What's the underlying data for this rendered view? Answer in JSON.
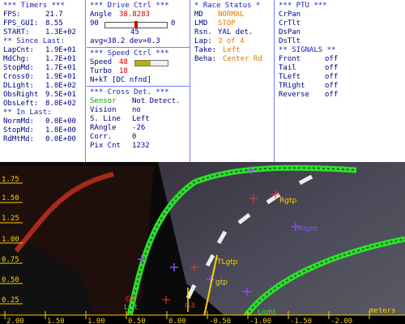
{
  "timers": {
    "title": "*** Timers ***",
    "rows": [
      {
        "label": "FPS:",
        "value": "21.7"
      },
      {
        "label": "FPS_GUI:",
        "value": "8.55"
      },
      {
        "label": "START:",
        "value": "1.3E+02"
      }
    ],
    "since_title": "** Since Last:",
    "since_rows": [
      {
        "label": "LapCnt:",
        "value": "1.9E+01"
      },
      {
        "label": "MdChg:",
        "value": "1.7E+01"
      },
      {
        "label": "StopMd:",
        "value": "1.7E+01"
      },
      {
        "label": "Cross0:",
        "value": "1.9E+01"
      },
      {
        "label": "DLight:",
        "value": "1.0E+02"
      },
      {
        "label": "ObsRight",
        "value": "9.5E+01"
      },
      {
        "label": "ObsLeft:",
        "value": "8.0E+02"
      }
    ],
    "inlast_title": "** In Last:",
    "inlast_rows": [
      {
        "label": "NormMd:",
        "value": "0.0E+00"
      },
      {
        "label": "StopMd:",
        "value": "1.8E+00"
      },
      {
        "label": "RdMtMd:",
        "value": "0.0E+00"
      }
    ]
  },
  "drive": {
    "title": "***  Drive Ctrl  ***",
    "angle_label": "Angle",
    "angle_value": "38.8283",
    "slider_min": "90",
    "slider_max": "0",
    "slider_level": 0.5,
    "slider_value": "45",
    "avg_text": "avg=38.2  dev=0.3",
    "speed_title": "***  Speed Ctrl  ***",
    "speed_label": "Speed",
    "speed_value": "48",
    "speed_gauge_level": 0.48,
    "turbo_label": "Turbo",
    "turbo_value": "18",
    "nkt_text": "N+kT [DC nfnd]",
    "cross_title": "*** Cross Det. ***",
    "sensor_label": "Sensor",
    "sensor_value": "Not Detect.",
    "vision_label": "Vision",
    "vision_value": "no",
    "sline_label": "S. Line",
    "sline_value": "Left",
    "rangle_label": "RAngle",
    "rangle_value": "-26",
    "corr_label": "Corr.",
    "corr_value": "0",
    "pix_label": "Pix Cnt",
    "pix_value": "1232"
  },
  "race": {
    "title": "* Race Status *",
    "rows": [
      {
        "label": "MD",
        "value": "NORMAL"
      },
      {
        "label": "LMD",
        "value": "STOP"
      },
      {
        "label": "Rsn.",
        "value": "YAL det."
      },
      {
        "label": "Lap:",
        "value": "3 of 4"
      },
      {
        "label": "Take:",
        "value": "Left"
      },
      {
        "label": "Beha:",
        "value": "Center Rd"
      }
    ]
  },
  "ptu": {
    "title": "*** PTU ***",
    "items": [
      "CrPan",
      "CrTlt",
      "DsPan",
      "DsTlt"
    ],
    "signals_title": "** SIGNALS **",
    "signals": [
      {
        "label": "Front",
        "value": "off"
      },
      {
        "label": "Tail",
        "value": "off"
      },
      {
        "label": "TLeft",
        "value": "off"
      },
      {
        "label": "TRight",
        "value": "off"
      },
      {
        "label": "Reverse",
        "value": "off"
      }
    ]
  },
  "video": {
    "y_ticks": [
      "1.75",
      "1.50",
      "1.25",
      "1.00",
      "0.75",
      "0.50",
      "0.25"
    ],
    "x_ticks": [
      "2.00",
      "1.50",
      "1.00",
      "0.50",
      "0.00",
      "-0.50",
      "-1.00",
      "-1.50",
      "-2.00"
    ],
    "units": "meters",
    "labels": {
      "tlgtp": "TLgtp",
      "rgtp": "Rgtp",
      "left": "Left",
      "right": "Right",
      "gtp": "gtp",
      "g1": "G1",
      "g3": "G3",
      "light": "Light"
    },
    "colors": {
      "line": "#2ee02e",
      "grid": "#ff3333",
      "marker": "#8a4dff",
      "label": "#ffd000"
    }
  }
}
